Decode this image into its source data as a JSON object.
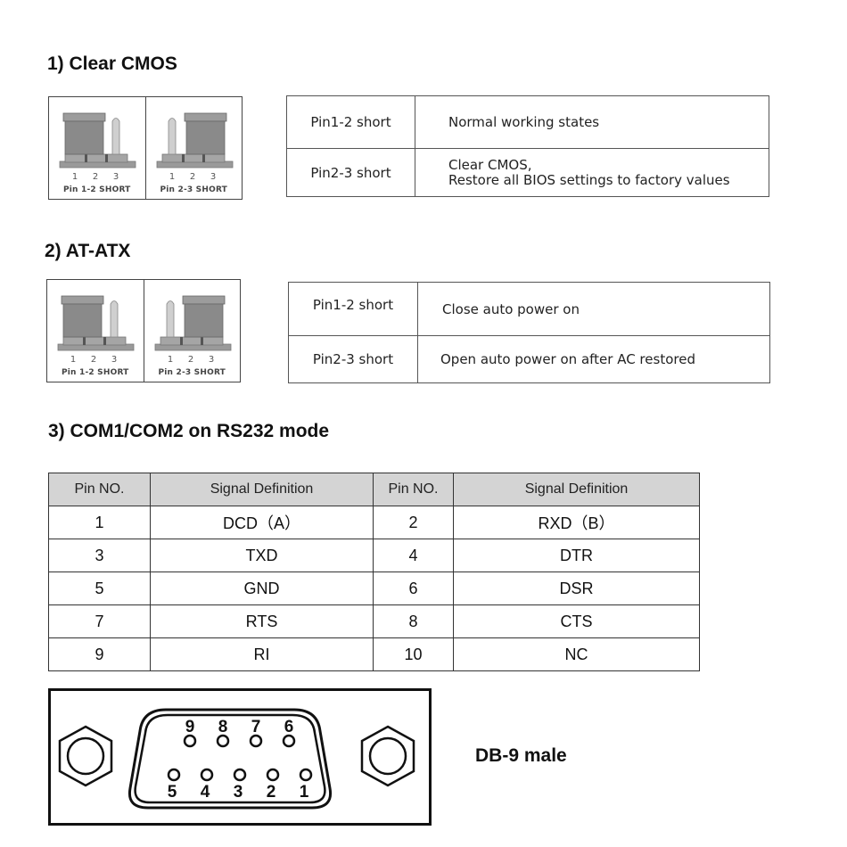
{
  "sections": {
    "clear_cmos": {
      "title": "1) Clear CMOS",
      "jumpers": {
        "left": {
          "pin_numbers": [
            "1",
            "2",
            "3"
          ],
          "caption": "Pin 1-2 SHORT"
        },
        "right": {
          "pin_numbers": [
            "1",
            "2",
            "3"
          ],
          "caption": "Pin 2-3 SHORT"
        }
      },
      "table": {
        "rows": [
          {
            "setting": "Pin1-2 short",
            "description_lines": [
              "Normal working states"
            ]
          },
          {
            "setting": "Pin2-3 short",
            "description_lines": [
              "Clear CMOS,",
              "Restore all BIOS settings to factory values"
            ]
          }
        ]
      }
    },
    "at_atx": {
      "title": "2) AT-ATX",
      "jumpers": {
        "left": {
          "pin_numbers": [
            "1",
            "2",
            "3"
          ],
          "caption": "Pin 1-2 SHORT"
        },
        "right": {
          "pin_numbers": [
            "1",
            "2",
            "3"
          ],
          "caption": "Pin 2-3 SHORT"
        }
      },
      "table": {
        "rows": [
          {
            "setting": "Pin1-2 short",
            "description_lines": [
              "Close auto power on"
            ]
          },
          {
            "setting": "Pin2-3 short",
            "description_lines": [
              "Open auto power on after AC restored"
            ]
          }
        ]
      }
    },
    "com_rs232": {
      "title": "3) COM1/COM2 on RS232 mode",
      "table": {
        "headers": [
          "Pin NO.",
          "Signal Definition",
          "Pin NO.",
          "Signal Definition"
        ],
        "rows": [
          [
            "1",
            "DCD（A）",
            "2",
            "RXD（B）"
          ],
          [
            "3",
            "TXD",
            "4",
            "DTR"
          ],
          [
            "5",
            "GND",
            "6",
            "DSR"
          ],
          [
            "7",
            "RTS",
            "8",
            "CTS"
          ],
          [
            "9",
            "RI",
            "10",
            "NC"
          ]
        ]
      },
      "connector": {
        "label": "DB-9 male",
        "top_row_pins": [
          "9",
          "8",
          "7",
          "6"
        ],
        "bottom_row_pins": [
          "5",
          "4",
          "3",
          "2",
          "1"
        ]
      }
    }
  },
  "colors": {
    "header_fill": "#d4d4d4",
    "jumper_cap": "#8a8a8a",
    "jumper_base": "#9a9a9a",
    "pin": "#cfcfcf"
  }
}
